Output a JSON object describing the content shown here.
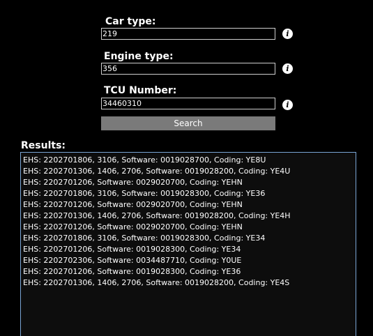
{
  "form": {
    "car_type": {
      "label": "Car type:",
      "value": "219"
    },
    "engine_type": {
      "label": "Engine type:",
      "value": "356"
    },
    "tcu_number": {
      "label": "TCU Number:",
      "value": "34460310"
    },
    "info_icon_glyph": "i",
    "search_label": "Search"
  },
  "results": {
    "label": "Results:",
    "lines": [
      "EHS: 2202701806, 3106, Software: 0019028700, Coding: YE8U",
      "EHS: 2202701306, 1406, 2706, Software: 0019028200, Coding: YE4U",
      "EHS: 2202701206, Software: 0029020700, Coding: YEHN",
      "EHS: 2202701806, 3106, Software: 0019028300, Coding: YE36",
      "EHS: 2202701206, Software: 0029020700, Coding: YEHN",
      "EHS: 2202701306, 1406, 2706, Software: 0019028200, Coding: YE4H",
      "EHS: 2202701206, Software: 0029020700, Coding: YEHN",
      "EHS: 2202701806, 3106, Software: 0019028300, Coding: YE34",
      "EHS: 2202701206, Software: 0019028300, Coding: YE34",
      "EHS: 2202702306, Software: 0034487710, Coding: Y0UE",
      "EHS: 2202701206, Software: 0019028300, Coding: YE36",
      "EHS: 2202701306, 1406, 2706, Software: 0019028200, Coding: YE4S"
    ]
  },
  "colors": {
    "background": "#000000",
    "text": "#ffffff",
    "button": "#7a7a7a",
    "results_border": "#7aa6d6"
  }
}
